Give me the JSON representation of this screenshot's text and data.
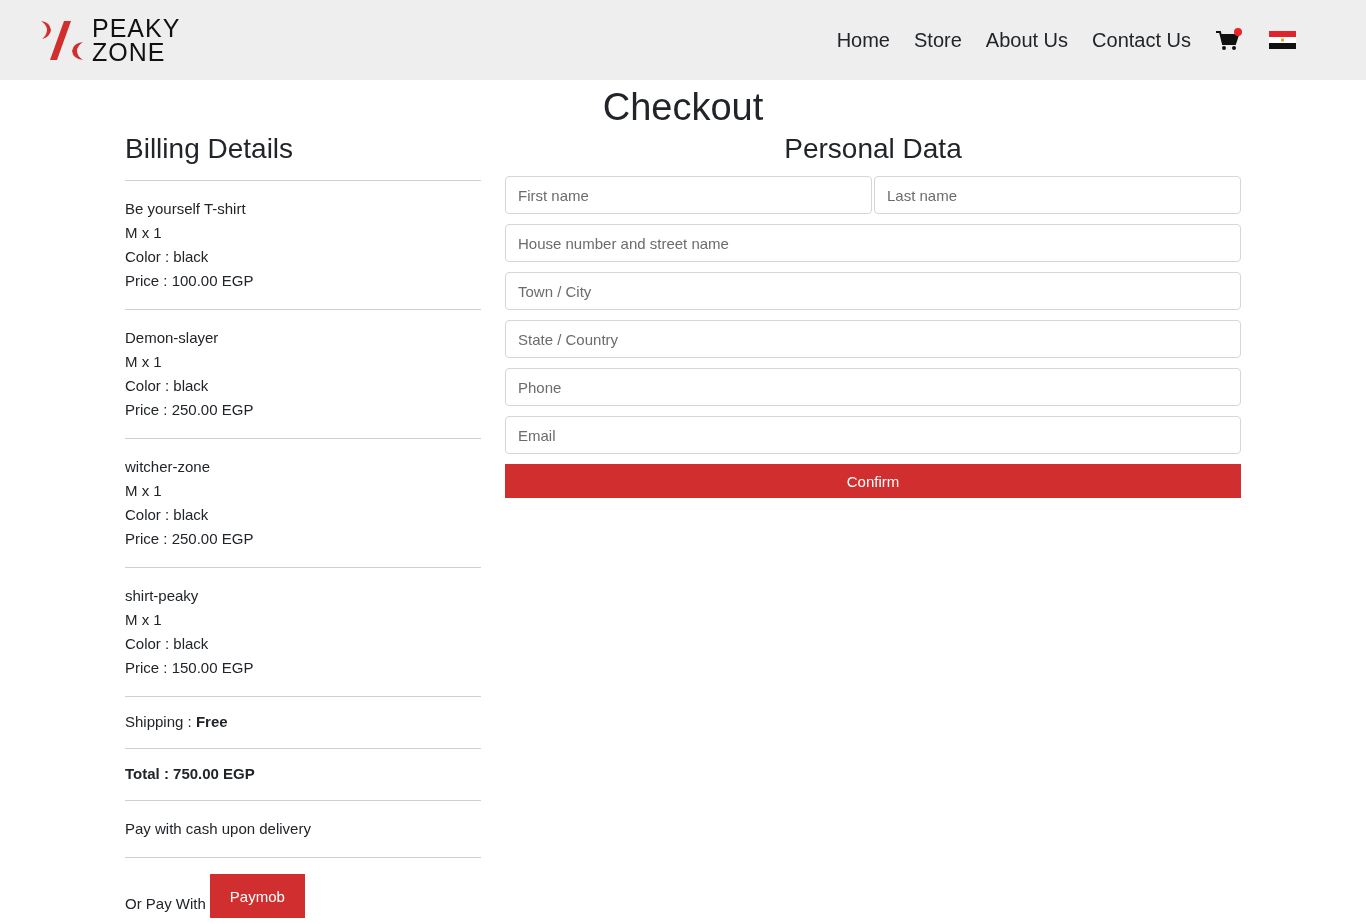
{
  "header": {
    "logo": {
      "line_1": "PEAKY",
      "line_2": "ZONE"
    },
    "nav": [
      {
        "label": "Home"
      },
      {
        "label": "Store"
      },
      {
        "label": "About Us"
      },
      {
        "label": "Contact Us"
      }
    ]
  },
  "page_title": "Checkout",
  "billing": {
    "title": "Billing Details",
    "items": [
      {
        "name": "Be yourself T-shirt",
        "quantity": "M x 1",
        "colour_text": "Color : black",
        "price": "Price : 100.00 EGP"
      },
      {
        "name": "Demon-slayer",
        "quantity": "M x 1",
        "colour_text": "Color : black",
        "price": "Price : 250.00 EGP"
      },
      {
        "name": "witcher-zone",
        "quantity": "M x 1",
        "colour_text": "Color : black",
        "price": "Price : 250.00 EGP"
      },
      {
        "name": "shirt-peaky",
        "quantity": "M x 1",
        "colour_text": "Color : black",
        "price": "Price : 150.00 EGP"
      }
    ],
    "shipping": "Shipping : **Free**",
    "total": "Total : 750.00 EGP",
    "cash_note": "Pay with cash upon delivery",
    "alt_payment": {
      "label": "Or Pay With",
      "button": "Paymob"
    }
  },
  "personal_data": {
    "title": "Personal Data",
    "name_fields": [
      {
        "placeholder": "First name"
      },
      {
        "placeholder": "Last name"
      }
    ],
    "fields": [
      {
        "placeholder": "House number and street name"
      },
      {
        "placeholder": "Town / City"
      },
      {
        "placeholder": "State / Country"
      },
      {
        "placeholder": "Phone"
      },
      {
        "placeholder": "Email"
      }
    ],
    "confirm": "Confirm"
  }
}
